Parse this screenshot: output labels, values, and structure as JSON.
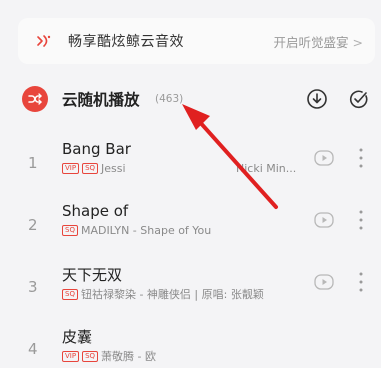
{
  "promo": {
    "text": "畅享酷炫鲸云音效",
    "action": "开启听觉盛宴",
    "chevron": ">",
    "icon": "speaker-wave-icon",
    "accent": "#e8453c"
  },
  "list_header": {
    "title": "云随机播放",
    "count": "(463)",
    "shuffle_icon": "shuffle-icon",
    "download_icon": "download-icon",
    "select_icon": "multi-select-check-icon"
  },
  "songs": [
    {
      "index": "1",
      "title": "Bang Bar",
      "badges": [
        "VIP",
        "SQ"
      ],
      "meta": "Jessi",
      "meta_tail": "Nicki Min..."
    },
    {
      "index": "2",
      "title": "Shape of",
      "badges": [
        "SQ"
      ],
      "meta": "MADILYN - Shape of You"
    },
    {
      "index": "3",
      "title": "天下无双",
      "badges": [
        "SQ"
      ],
      "meta": "钮祜禄黎染 - 神雕侠侣 | 原唱: 张靓颖"
    },
    {
      "index": "4",
      "title": "皮囊",
      "badges": [
        "VIP",
        "SQ"
      ],
      "meta": "萧敬腾 - 欧"
    }
  ],
  "colors": {
    "background": "#f4f4f6",
    "accent": "#e8453c",
    "arrow": "#e02020",
    "text_primary": "#222222",
    "text_secondary": "#8a8a8a"
  }
}
